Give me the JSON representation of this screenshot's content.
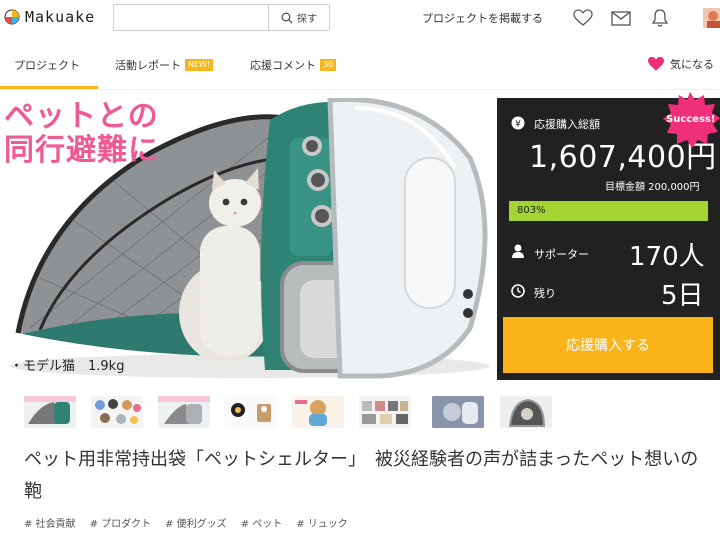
{
  "header": {
    "logo_text": "Makuake",
    "search_placeholder": "",
    "search_button": "探す",
    "post_project": "プロジェクトを掲載する",
    "icons": [
      "heart-icon",
      "mail-icon",
      "bell-icon",
      "avatar"
    ]
  },
  "tabs": [
    {
      "label": "プロジェクト",
      "active": true
    },
    {
      "label": "活動レポート",
      "badge": "NEW!"
    },
    {
      "label": "応援コメント",
      "badge": "30"
    }
  ],
  "favorite_label": "気になる",
  "hero": {
    "title_line1": "ペットとの",
    "title_line2": "同行避難に",
    "caption": "・モデル猫　1.9kg"
  },
  "panel": {
    "total_label": "応援購入総額",
    "total_amount": "1,607,400円",
    "goal": "目標金額 200,000円",
    "progress_text": "803%",
    "progress_fraction": 1.0,
    "supporters_label": "サポーター",
    "supporters_value": "170人",
    "remaining_label": "残り",
    "remaining_value": "5日",
    "buy_button": "応援購入する",
    "success_badge": "Success!"
  },
  "thumbnails_count": 8,
  "project_title": "ペット用非常持出袋「ペットシェルター」　被災経験者の声が詰まったペット想いの鞄",
  "tags": [
    "# 社会貢献",
    "# プロダクト",
    "# 便利グッズ",
    "# ペット",
    "# リュック"
  ],
  "colors": {
    "accent_yellow": "#fbb31a",
    "pink": "#ef5a92",
    "progress_green": "#a2d532",
    "panel_bg": "#212121"
  }
}
